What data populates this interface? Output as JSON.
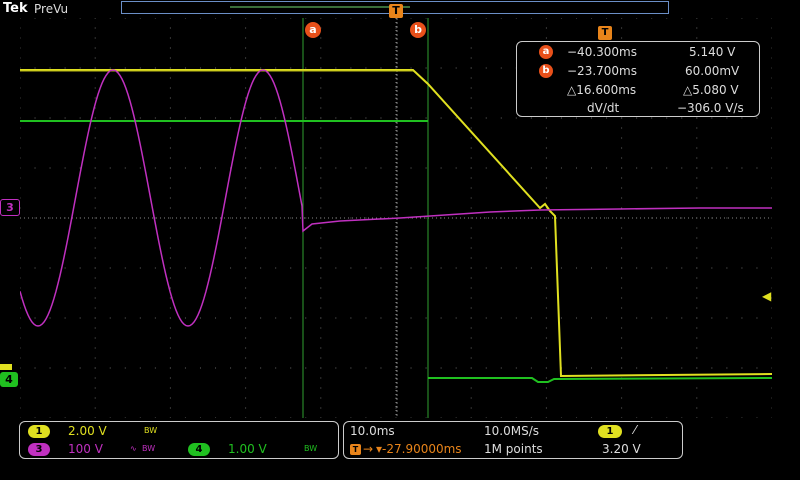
{
  "header": {
    "brand": "Tek",
    "mode": "PreVu"
  },
  "markers": {
    "cursor_a": "a",
    "cursor_b": "b",
    "trigger": "T"
  },
  "channel_tags": {
    "ch3": "3",
    "ch4": "4"
  },
  "cursor_readout": {
    "icon": "T",
    "a_time": "−40.300ms",
    "a_value": "5.140 V",
    "b_time": "−23.700ms",
    "b_value": "60.00mV",
    "delta_time": "△16.600ms",
    "delta_value": "△5.080 V",
    "slope_label": "dV/dt",
    "slope_value": "−306.0 V/s"
  },
  "channels": {
    "ch1": {
      "num": "1",
      "scale": "2.00 V",
      "bw": "BW",
      "color": "#e0e020"
    },
    "ch3": {
      "num": "3",
      "scale": "100 V",
      "bw": "BW",
      "color": "#c030c0"
    },
    "ch4": {
      "num": "4",
      "scale": "1.00 V",
      "bw": "BW",
      "color": "#20c020"
    }
  },
  "acquisition": {
    "time_per_div": "10.0ms",
    "sample_rate": "10.0MS/s",
    "trigger_delay": "▾-27.90000ms",
    "record_length": "1M points",
    "trigger_channel": "1",
    "trigger_slope": "⁄",
    "trigger_level": "3.20 V"
  },
  "colors": {
    "cursor_marker": "#e8501a",
    "trigger_marker": "#e8841a",
    "grid": "#555555"
  }
}
